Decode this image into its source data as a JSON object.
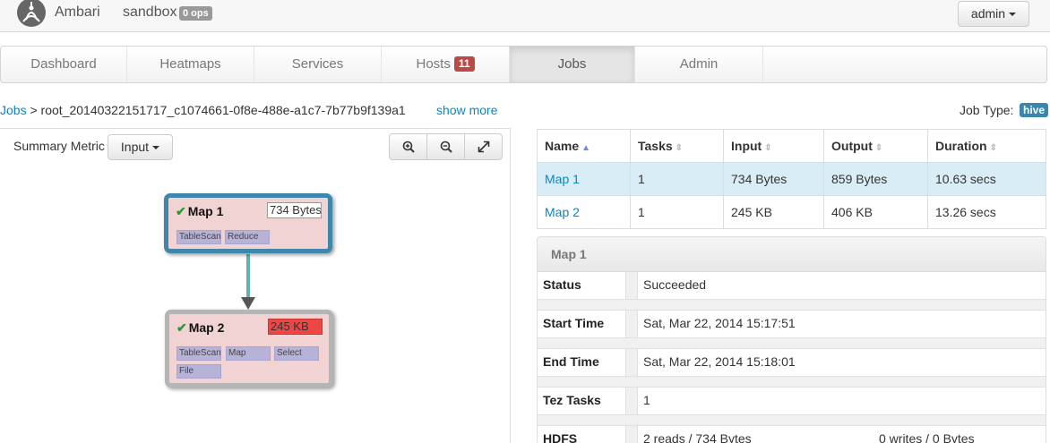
{
  "topbar": {
    "brand": "Ambari",
    "cluster": "sandbox",
    "ops_badge": "0 ops",
    "user_menu": "admin"
  },
  "nav": {
    "tabs": [
      {
        "label": "Dashboard"
      },
      {
        "label": "Heatmaps"
      },
      {
        "label": "Services"
      },
      {
        "label": "Hosts",
        "badge": "11"
      },
      {
        "label": "Jobs",
        "active": true
      },
      {
        "label": "Admin"
      }
    ]
  },
  "breadcrumb": {
    "root": "Jobs",
    "separator": ">",
    "job_id": "root_20140322151717_c1074661-0f8e-488e-a1c7-7b77b9f139a1",
    "show_more": "show more"
  },
  "job_type": {
    "label": "Job Type:",
    "value": "hive"
  },
  "graph": {
    "summary_metric_label": "Summary Metric",
    "metric_select": "Input",
    "nodes": [
      {
        "name": "Map 1",
        "metric": "734 Bytes",
        "operators": [
          "TableScan",
          "Reduce"
        ]
      },
      {
        "name": "Map 2",
        "metric": "245 KB",
        "operators": [
          "TableScan",
          "Map",
          "Select",
          "File"
        ]
      }
    ]
  },
  "tasks_table": {
    "columns": [
      "Name",
      "Tasks",
      "Input",
      "Output",
      "Duration"
    ],
    "rows": [
      {
        "name": "Map 1",
        "tasks": "1",
        "input": "734 Bytes",
        "output": "859 Bytes",
        "duration": "10.63 secs"
      },
      {
        "name": "Map 2",
        "tasks": "1",
        "input": "245 KB",
        "output": "406 KB",
        "duration": "13.26 secs"
      }
    ]
  },
  "detail": {
    "title": "Map 1",
    "rows": [
      {
        "key": "Status",
        "value": "Succeeded"
      },
      {
        "key": "Start Time",
        "value": "Sat, Mar 22, 2014 15:17:51"
      },
      {
        "key": "End Time",
        "value": "Sat, Mar 22, 2014 15:18:01"
      },
      {
        "key": "Tez Tasks",
        "value": "1"
      },
      {
        "key": "HDFS",
        "value": "2 reads / 734 Bytes",
        "value2": "0 writes / 0 Bytes"
      }
    ]
  },
  "colors": {
    "accent": "#0088cc",
    "selected_node_border": "#3f86ab",
    "edge": "#5fb3b3",
    "metric_hot": "#ee4545",
    "badge_danger": "#b94a48",
    "badge_info": "#3a87ad"
  }
}
